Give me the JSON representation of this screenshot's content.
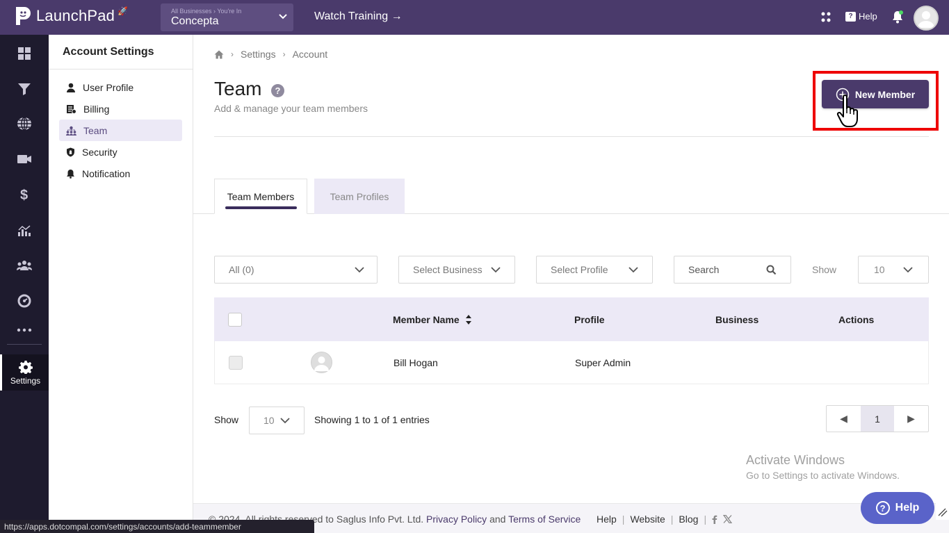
{
  "app": {
    "name": "LaunchPad",
    "business_crumb": "All Businesses › You're In",
    "business_name": "Concepta",
    "watch_training": "Watch Training →",
    "help_label": "Help"
  },
  "rail": {
    "items": [
      "dashboard-icon",
      "funnel-icon",
      "globe-icon",
      "video-icon",
      "dollar-icon",
      "analytics-icon",
      "users-icon",
      "gauge-icon",
      "more-icon"
    ],
    "settings_label": "Settings"
  },
  "sidebar": {
    "title": "Account Settings",
    "items": [
      {
        "label": "User Profile",
        "icon": "user-icon"
      },
      {
        "label": "Billing",
        "icon": "billing-icon"
      },
      {
        "label": "Team",
        "icon": "team-icon",
        "active": true
      },
      {
        "label": "Security",
        "icon": "shield-icon"
      },
      {
        "label": "Notification",
        "icon": "bell-icon"
      }
    ]
  },
  "breadcrumb": {
    "items": [
      "Settings",
      "Account"
    ]
  },
  "page": {
    "title": "Team",
    "subtitle": "Add & manage your team members",
    "new_member_label": "New Member"
  },
  "tabs": [
    {
      "label": "Team Members",
      "active": true
    },
    {
      "label": "Team Profiles",
      "active": false
    }
  ],
  "filters": {
    "status": "All (0)",
    "business": "Select Business",
    "profile": "Select Profile",
    "search_placeholder": "Search",
    "show_label": "Show",
    "show_value": "10"
  },
  "table": {
    "headers": {
      "member_name": "Member Name",
      "profile": "Profile",
      "business": "Business",
      "actions": "Actions"
    },
    "rows": [
      {
        "name": "Bill Hogan",
        "profile": "Super Admin",
        "business": ""
      }
    ]
  },
  "pagination": {
    "show_label": "Show",
    "show_value": "10",
    "entries_text": "Showing 1 to 1 of 1 entries",
    "prev": "◀",
    "current": "1",
    "next": "▶"
  },
  "watermark": {
    "line1": "Activate Windows",
    "line2": "Go to Settings to activate Windows."
  },
  "footer": {
    "copyright": "© 2024. All rights reserved to Saglus Info Pvt. Ltd.",
    "privacy": "Privacy Policy",
    "and": "and",
    "terms": "Terms of Service",
    "help": "Help",
    "website": "Website",
    "blog": "Blog"
  },
  "status_url": "https://apps.dotcompal.com/settings/accounts/add-teammember",
  "help_float_label": "Help",
  "colors": {
    "brand": "#4a3a6b",
    "rail": "#1e1b2e",
    "highlight": "#ee0000",
    "help_float": "#5a63c9"
  }
}
